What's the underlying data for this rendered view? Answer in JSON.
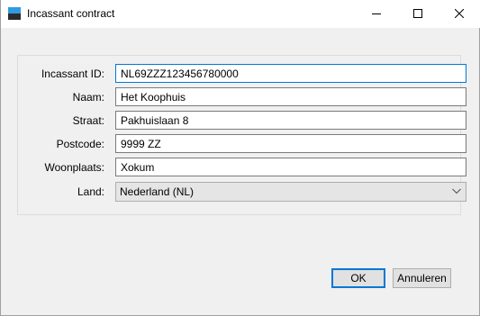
{
  "window": {
    "title": "Incassant contract",
    "icon": "app-icon",
    "controls": [
      "minimize-icon",
      "maximize-icon",
      "close-icon"
    ]
  },
  "form": {
    "incassant_id": {
      "label": "Incassant ID:",
      "value": "NL69ZZZ123456780000"
    },
    "naam": {
      "label": "Naam:",
      "value": "Het Koophuis"
    },
    "straat": {
      "label": "Straat:",
      "value": "Pakhuislaan 8"
    },
    "postcode": {
      "label": "Postcode:",
      "value": "9999 ZZ"
    },
    "woonplaats": {
      "label": "Woonplaats:",
      "value": "Xokum"
    },
    "land": {
      "label": "Land:",
      "value": "Nederland (NL)",
      "icon": "chevron-down-icon"
    }
  },
  "buttons": {
    "ok": "OK",
    "cancel": "Annuleren"
  },
  "colors": {
    "focus_border": "#0078d7",
    "dialog_background": "#f0f0f0",
    "titlebar_background": "#ffffff"
  }
}
